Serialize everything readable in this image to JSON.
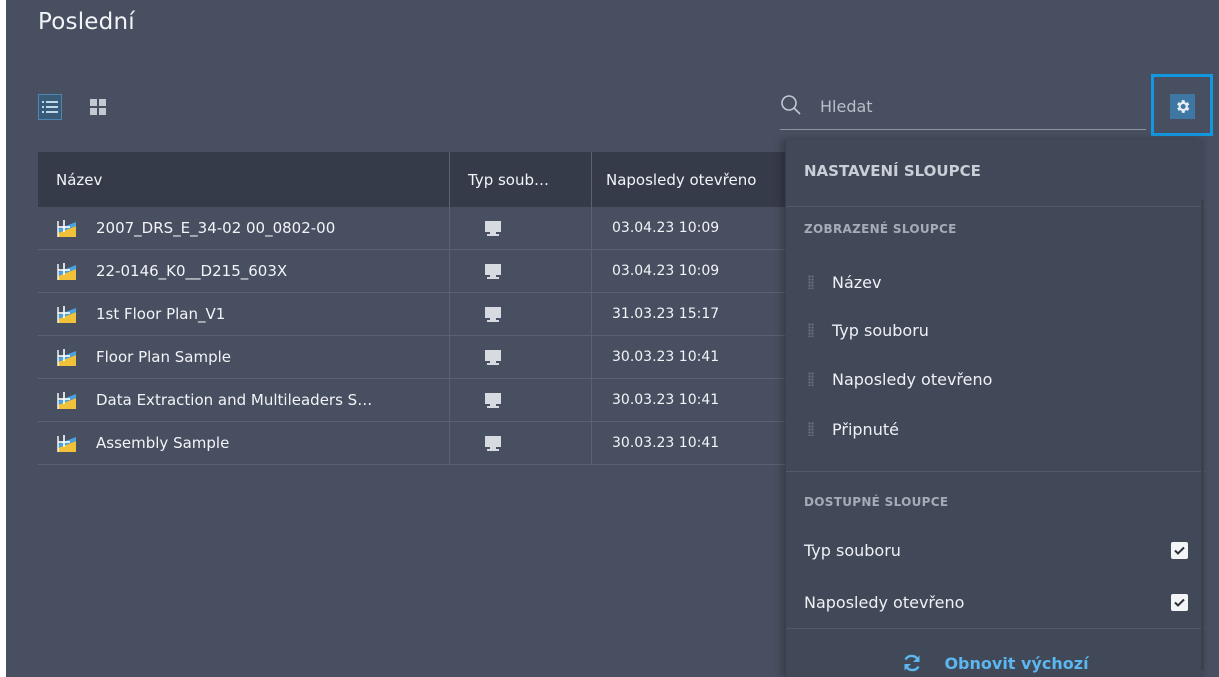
{
  "page": {
    "title": "Poslední"
  },
  "toolbar": {
    "list_view_icon": "list-view-icon",
    "grid_view_icon": "grid-view-icon"
  },
  "search": {
    "placeholder": "Hledat",
    "icon": "search-icon"
  },
  "settings": {
    "icon": "gear-icon"
  },
  "table": {
    "columns": [
      "Název",
      "Typ soub…",
      "Naposledy otevřeno"
    ],
    "rows": [
      {
        "name": "2007_DRS_E_34-02 00_0802-00",
        "type_icon": "computer-icon",
        "opened": "03.04.23 10:09"
      },
      {
        "name": "22-0146_K0__D215_603X",
        "type_icon": "computer-icon",
        "opened": "03.04.23 10:09"
      },
      {
        "name": "1st Floor Plan_V1",
        "type_icon": "computer-icon",
        "opened": "31.03.23 15:17"
      },
      {
        "name": "Floor Plan Sample",
        "type_icon": "computer-icon",
        "opened": "30.03.23 10:41"
      },
      {
        "name": "Data Extraction and Multileaders S…",
        "type_icon": "computer-icon",
        "opened": "30.03.23 10:41"
      },
      {
        "name": "Assembly Sample",
        "type_icon": "computer-icon",
        "opened": "30.03.23 10:41"
      }
    ]
  },
  "column_settings": {
    "title": "NASTAVENÍ SLOUPCE",
    "shown_label": "ZOBRAZENÉ SLOUPCE",
    "shown": [
      "Název",
      "Typ souboru",
      "Naposledy otevřeno",
      "Připnuté"
    ],
    "available_label": "DOSTUPNÉ SLOUPCE",
    "available": [
      {
        "label": "Typ souboru",
        "checked": true
      },
      {
        "label": "Naposledy otevřeno",
        "checked": true
      }
    ],
    "reset_label": "Obnovit výchozí",
    "reset_icon": "refresh-icon"
  },
  "colors": {
    "background": "#474f60",
    "header": "#353b48",
    "panel": "#414958",
    "accent": "#5cb6ef",
    "highlight_border": "#1297e0"
  }
}
